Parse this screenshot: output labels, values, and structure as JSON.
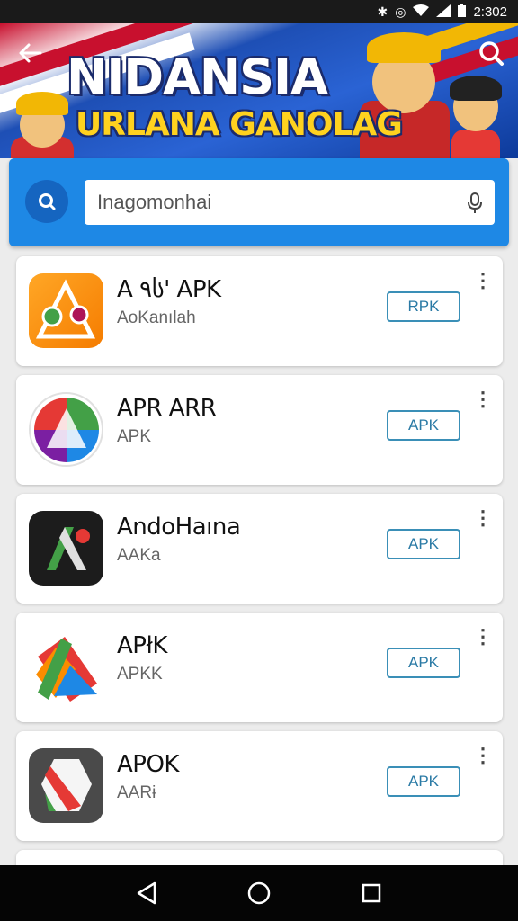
{
  "status_bar": {
    "time": "2:302"
  },
  "header": {
    "title": "NIDANSIA",
    "subtitle": "URLANA GANOLAG",
    "back_icon": "arrow-left-icon",
    "search_icon": "search-icon"
  },
  "search": {
    "value": "Inagomonhai",
    "icon": "search-icon",
    "mic_icon": "mic-icon"
  },
  "apps": [
    {
      "name": "A ٩ს' APK",
      "sub": "AoKanılah",
      "button": "RPK"
    },
    {
      "name": "APR ARR",
      "sub": "APK",
      "button": "APK"
    },
    {
      "name": "AndoHaına",
      "sub": "AAKa",
      "button": "APK"
    },
    {
      "name": "APłK",
      "sub": "APKK",
      "button": "APK"
    },
    {
      "name": "APOK",
      "sub": "AARɨ",
      "button": "APK"
    }
  ],
  "colors": {
    "accent": "#1e88e5",
    "button_border": "#3a8fb7",
    "nav_bg": "#050505"
  }
}
